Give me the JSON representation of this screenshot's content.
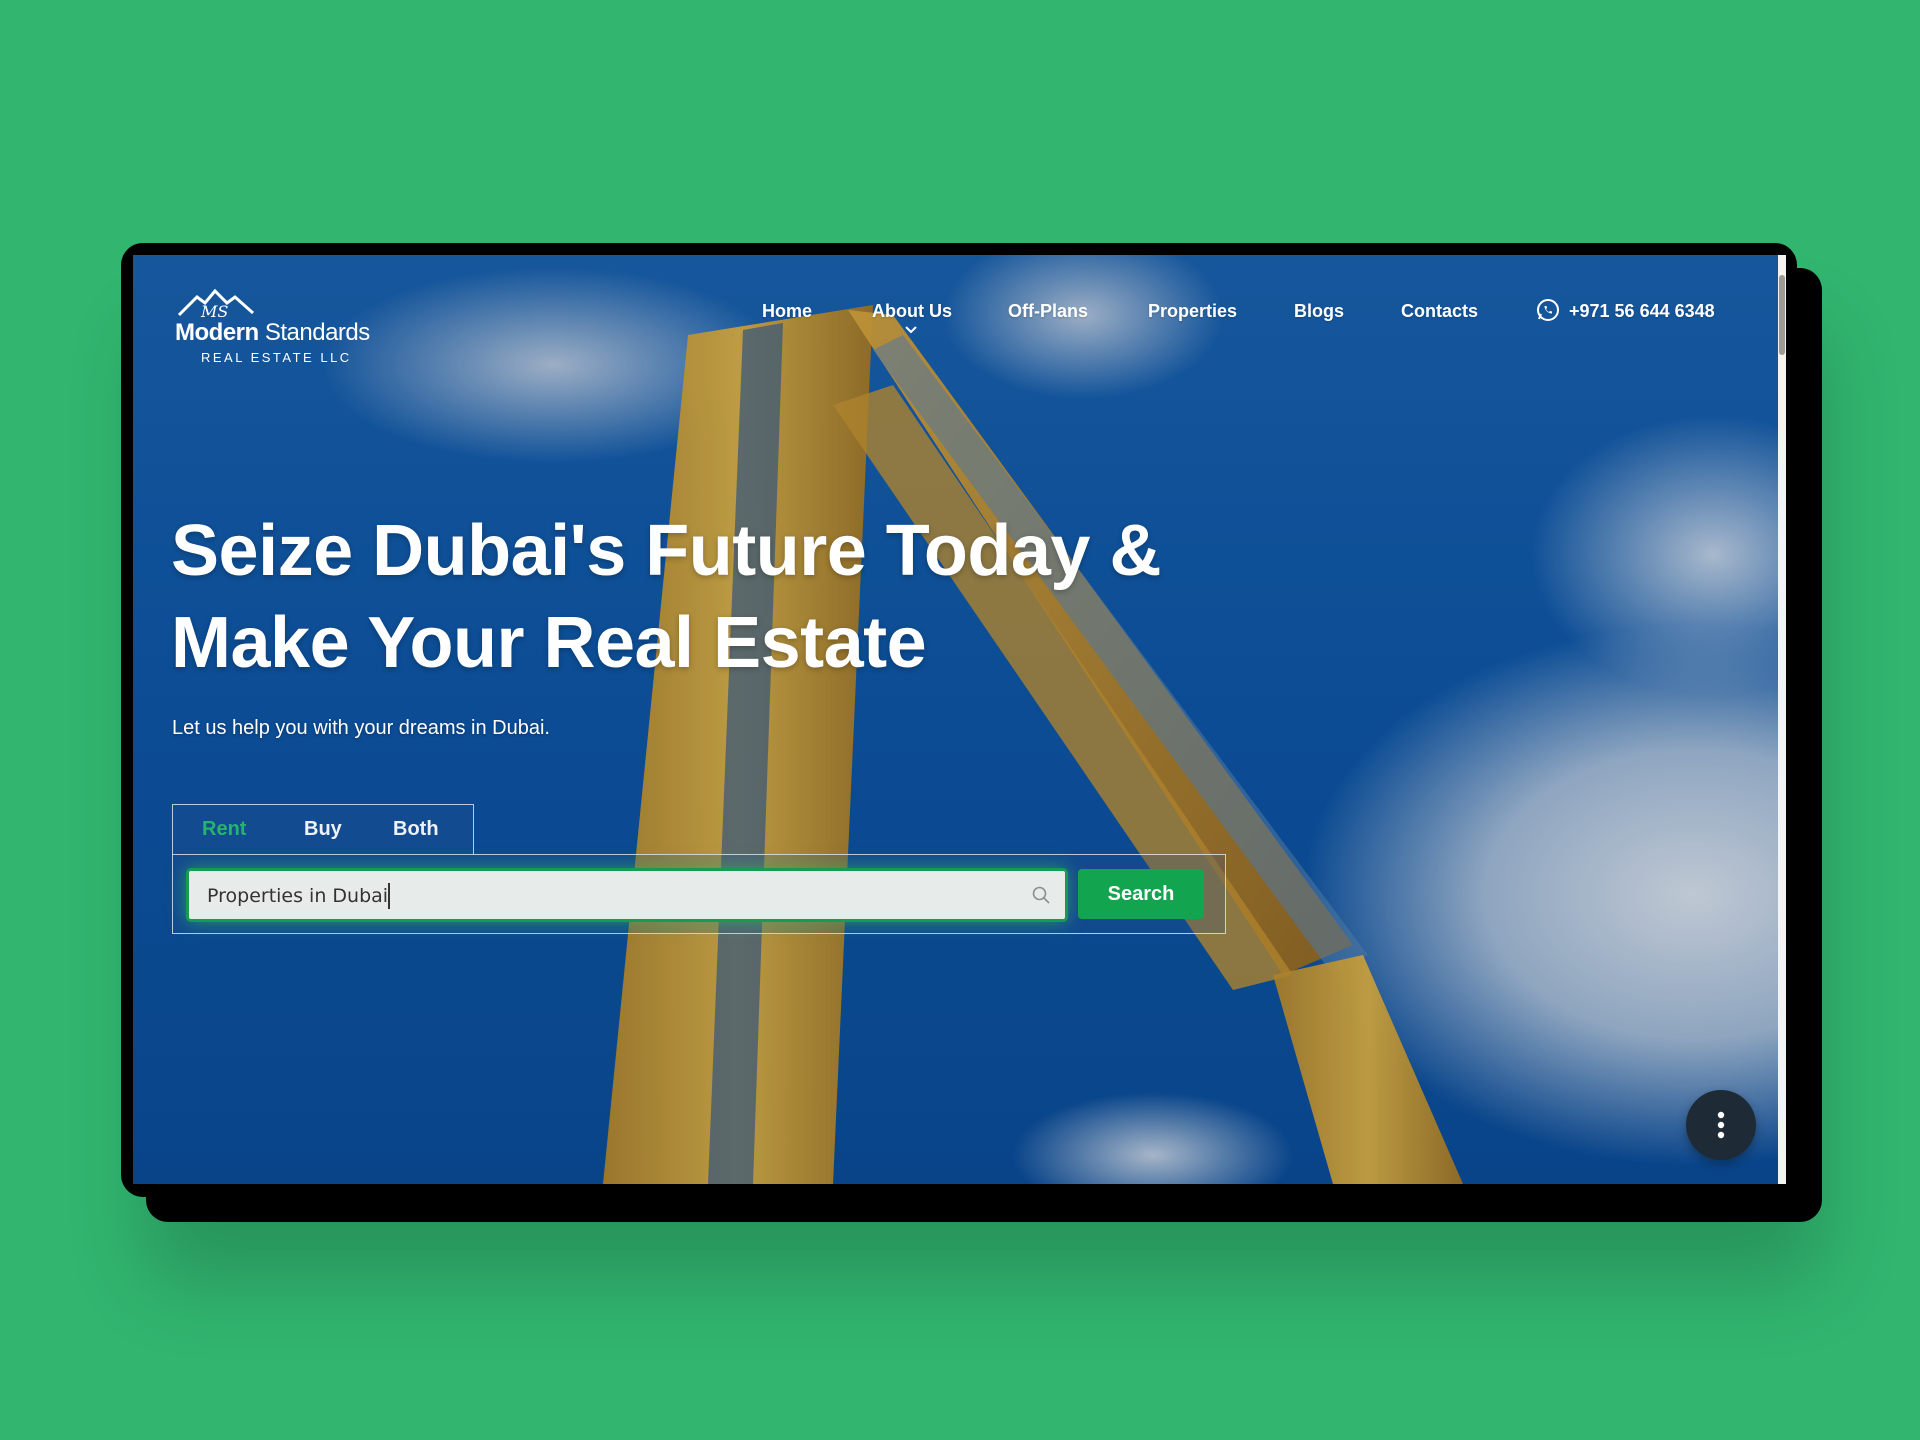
{
  "page": {
    "background_color": "#31b56f",
    "accent_color": "#12a44f"
  },
  "brand": {
    "logo_mark": "MS",
    "name_bold": "Modern",
    "name_light": "Standards",
    "subtitle": "REAL ESTATE LLC"
  },
  "nav": {
    "items": [
      {
        "label": "Home"
      },
      {
        "label": "About Us",
        "has_dropdown": true
      },
      {
        "label": "Off-Plans"
      },
      {
        "label": "Properties"
      },
      {
        "label": "Blogs"
      },
      {
        "label": "Contacts"
      }
    ],
    "phone": {
      "icon": "whatsapp-icon",
      "label": "+971 56 644 6348"
    }
  },
  "hero": {
    "headline_line1": "Seize Dubai's Future Today &",
    "headline_line2": "Make Your Real Estate",
    "subline": "Let us help you with your dreams in Dubai."
  },
  "search": {
    "tabs": [
      {
        "label": "Rent",
        "active": true
      },
      {
        "label": "Buy",
        "active": false
      },
      {
        "label": "Both",
        "active": false
      }
    ],
    "input_value": "Properties in Dubai",
    "button_label": "Search"
  },
  "fab": {
    "icon": "more-vertical-icon"
  }
}
